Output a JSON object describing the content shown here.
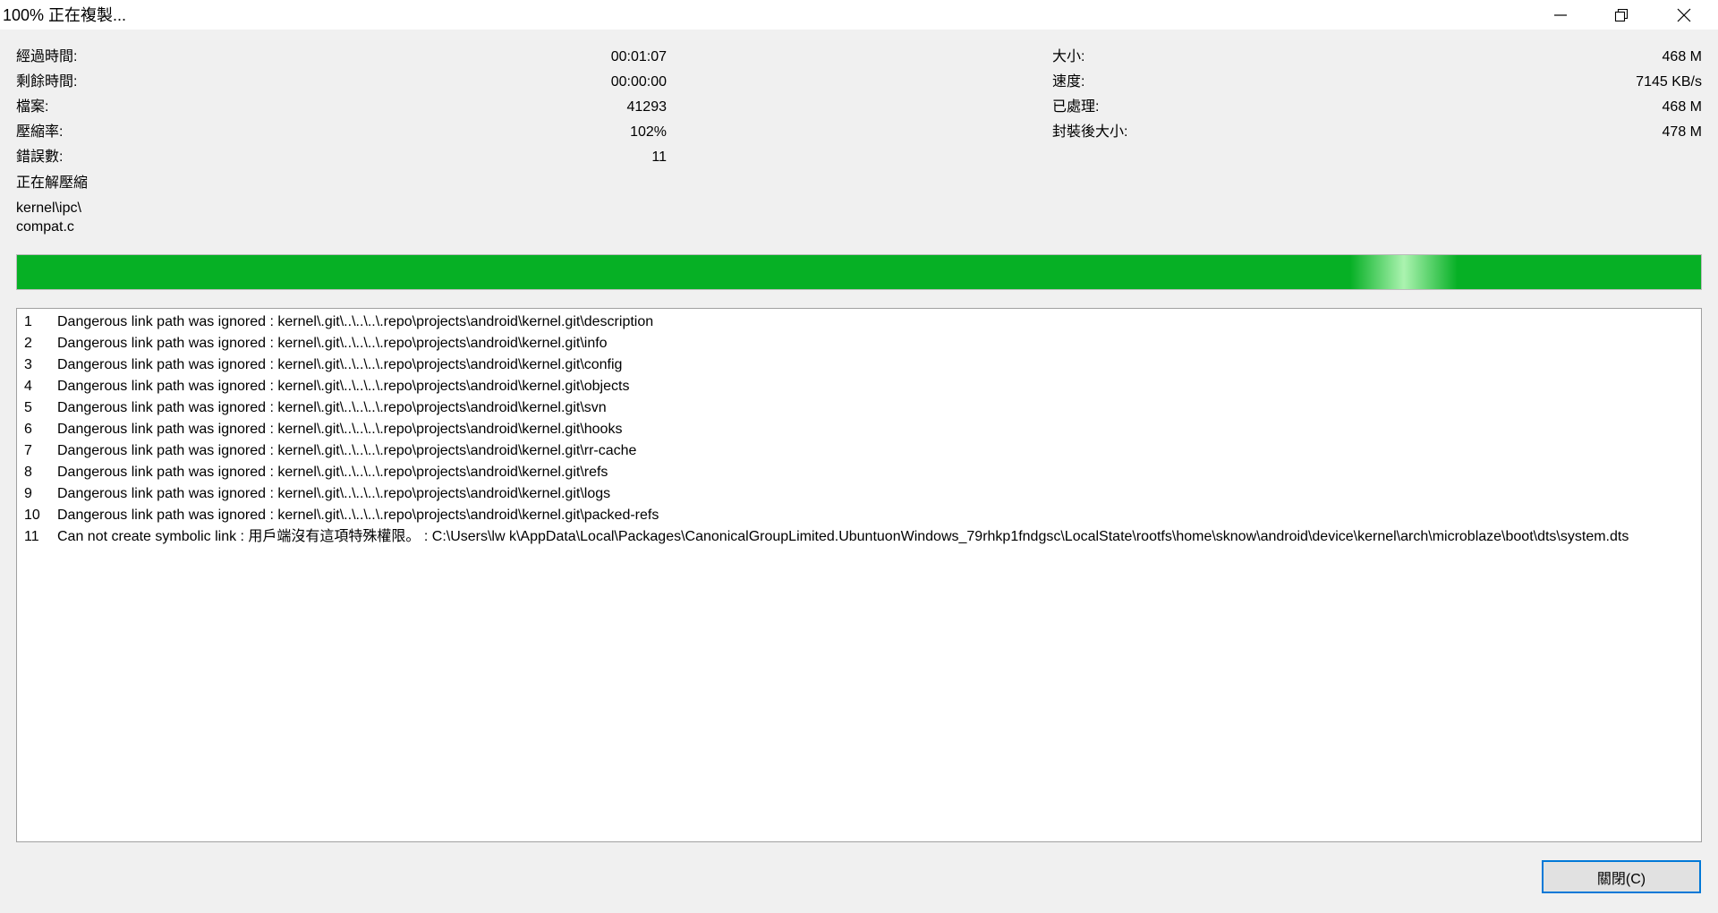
{
  "window": {
    "title": "100% 正在複製..."
  },
  "stats_left": [
    {
      "label": "經過時間:",
      "value": "00:01:07"
    },
    {
      "label": "剩餘時間:",
      "value": "00:00:00"
    },
    {
      "label": "檔案:",
      "value": "41293"
    },
    {
      "label": "壓縮率:",
      "value": "102%"
    },
    {
      "label": "錯誤數:",
      "value": "11"
    }
  ],
  "stats_right": [
    {
      "label": "大小:",
      "value": "468 M"
    },
    {
      "label": "速度:",
      "value": "7145 KB/s"
    },
    {
      "label": "已處理:",
      "value": "468 M"
    },
    {
      "label": "封裝後大小:",
      "value": "478 M"
    }
  ],
  "status": {
    "operation": "正在解壓縮",
    "current_folder": "kernel\\ipc\\",
    "current_file": "compat.c"
  },
  "progress": {
    "fraction": 1.0,
    "color": "#06b025"
  },
  "log": [
    {
      "num": "1",
      "text": "Dangerous link path was ignored : kernel\\.git\\..\\..\\..\\.repo\\projects\\android\\kernel.git\\description"
    },
    {
      "num": "2",
      "text": "Dangerous link path was ignored : kernel\\.git\\..\\..\\..\\.repo\\projects\\android\\kernel.git\\info"
    },
    {
      "num": "3",
      "text": "Dangerous link path was ignored : kernel\\.git\\..\\..\\..\\.repo\\projects\\android\\kernel.git\\config"
    },
    {
      "num": "4",
      "text": "Dangerous link path was ignored : kernel\\.git\\..\\..\\..\\.repo\\projects\\android\\kernel.git\\objects"
    },
    {
      "num": "5",
      "text": "Dangerous link path was ignored : kernel\\.git\\..\\..\\..\\.repo\\projects\\android\\kernel.git\\svn"
    },
    {
      "num": "6",
      "text": "Dangerous link path was ignored : kernel\\.git\\..\\..\\..\\.repo\\projects\\android\\kernel.git\\hooks"
    },
    {
      "num": "7",
      "text": "Dangerous link path was ignored : kernel\\.git\\..\\..\\..\\.repo\\projects\\android\\kernel.git\\rr-cache"
    },
    {
      "num": "8",
      "text": "Dangerous link path was ignored : kernel\\.git\\..\\..\\..\\.repo\\projects\\android\\kernel.git\\refs"
    },
    {
      "num": "9",
      "text": "Dangerous link path was ignored : kernel\\.git\\..\\..\\..\\.repo\\projects\\android\\kernel.git\\logs"
    },
    {
      "num": "10",
      "text": "Dangerous link path was ignored : kernel\\.git\\..\\..\\..\\.repo\\projects\\android\\kernel.git\\packed-refs"
    },
    {
      "num": "11",
      "text": "Can not create symbolic link : 用戶端沒有這項特殊權限。 : C:\\Users\\lw k\\AppData\\Local\\Packages\\CanonicalGroupLimited.UbuntuonWindows_79rhkp1fndgsc\\LocalState\\rootfs\\home\\sknow\\android\\device\\kernel\\arch\\microblaze\\boot\\dts\\system.dts"
    }
  ],
  "buttons": {
    "close_label": "關閉(C)"
  },
  "icons": {
    "minimize": "minimize-icon",
    "restore": "restore-icon",
    "close": "close-icon"
  }
}
